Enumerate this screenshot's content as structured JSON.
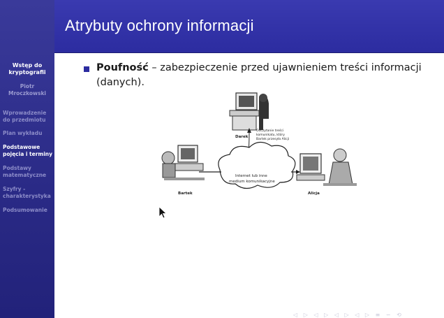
{
  "sidebar": {
    "title_line1": "Wstęp do",
    "title_line2": "kryptografii",
    "author_line1": "Piotr",
    "author_line2": "Mroczkowski",
    "items": [
      {
        "line1": "Wprowadzenie",
        "line2": "do przedmiotu",
        "active": false
      },
      {
        "line1": "Plan wykładu",
        "line2": "",
        "active": false
      },
      {
        "line1": "Podstawowe",
        "line2": "pojęcia i terminy",
        "active": true
      },
      {
        "line1": "Podstawy",
        "line2": "matematyczne",
        "active": false
      },
      {
        "line1": "Szyfry -",
        "line2": "charakterystyka",
        "active": false
      },
      {
        "line1": "Podsumowanie",
        "line2": "",
        "active": false
      }
    ]
  },
  "header": {
    "title": "Atrybuty ochrony informacji"
  },
  "content": {
    "term": "Poufność",
    "definition": " – zabezpieczenie przed ujawnieniem treści informacji",
    "definition_cont": "(danych)."
  },
  "illustration": {
    "label_darek": "Darek",
    "note_line1": "Odczytanie treści",
    "note_line2": "komunikatu, który",
    "note_line3": "Bartek przesyła Alicji",
    "cloud_line1": "Internet lub inne",
    "cloud_line2": "medium komunikacyjne",
    "label_bartek": "Bartek",
    "label_alicja": "Alicja"
  },
  "navbar": {
    "icons": [
      "◁",
      "▷",
      "◁",
      "▷",
      "◁",
      "▷",
      "◁",
      "▷",
      "≡",
      "∽",
      "⟲"
    ]
  },
  "colors": {
    "sidebar_bg": "#2a2a86",
    "header_bg": "#2c2ca0",
    "active_text": "#ffffff",
    "inactive_text": "#8c8cc8"
  }
}
